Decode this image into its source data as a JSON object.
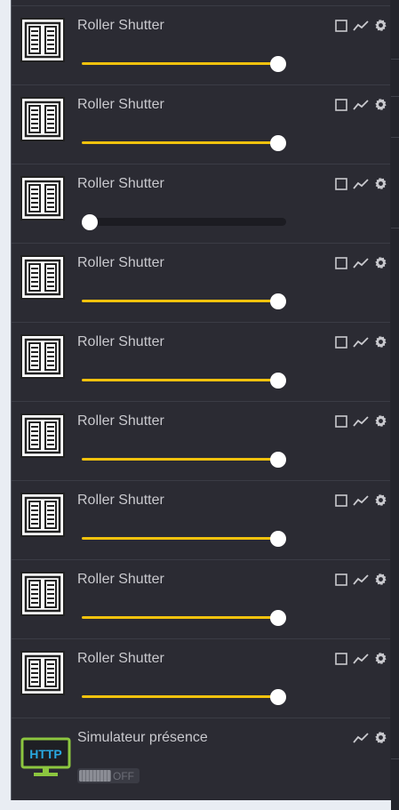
{
  "devices": [
    {
      "title": "Roller Shutter",
      "level": 100
    },
    {
      "title": "Roller Shutter",
      "level": 100
    },
    {
      "title": "Roller Shutter",
      "level": 0
    },
    {
      "title": "Roller Shutter",
      "level": 100
    },
    {
      "title": "Roller Shutter",
      "level": 100
    },
    {
      "title": "Roller Shutter",
      "level": 100
    },
    {
      "title": "Roller Shutter",
      "level": 100
    },
    {
      "title": "Roller Shutter",
      "level": 100
    },
    {
      "title": "Roller Shutter",
      "level": 100
    }
  ],
  "simulator": {
    "title": "Simulateur présence",
    "icon_text": "HTTP",
    "toggle_label": "OFF",
    "toggle_state": "off"
  },
  "icons": {
    "device": "roller-shutter-icon",
    "checkbox": "checkbox-icon",
    "chart": "chart-icon",
    "settings": "gear-icon",
    "http": "http-monitor-icon"
  },
  "colors": {
    "slider_active": "#f2c20d",
    "http_green": "#8cc63f",
    "http_text": "#29a8e0",
    "panel_bg": "#2b2b33"
  }
}
